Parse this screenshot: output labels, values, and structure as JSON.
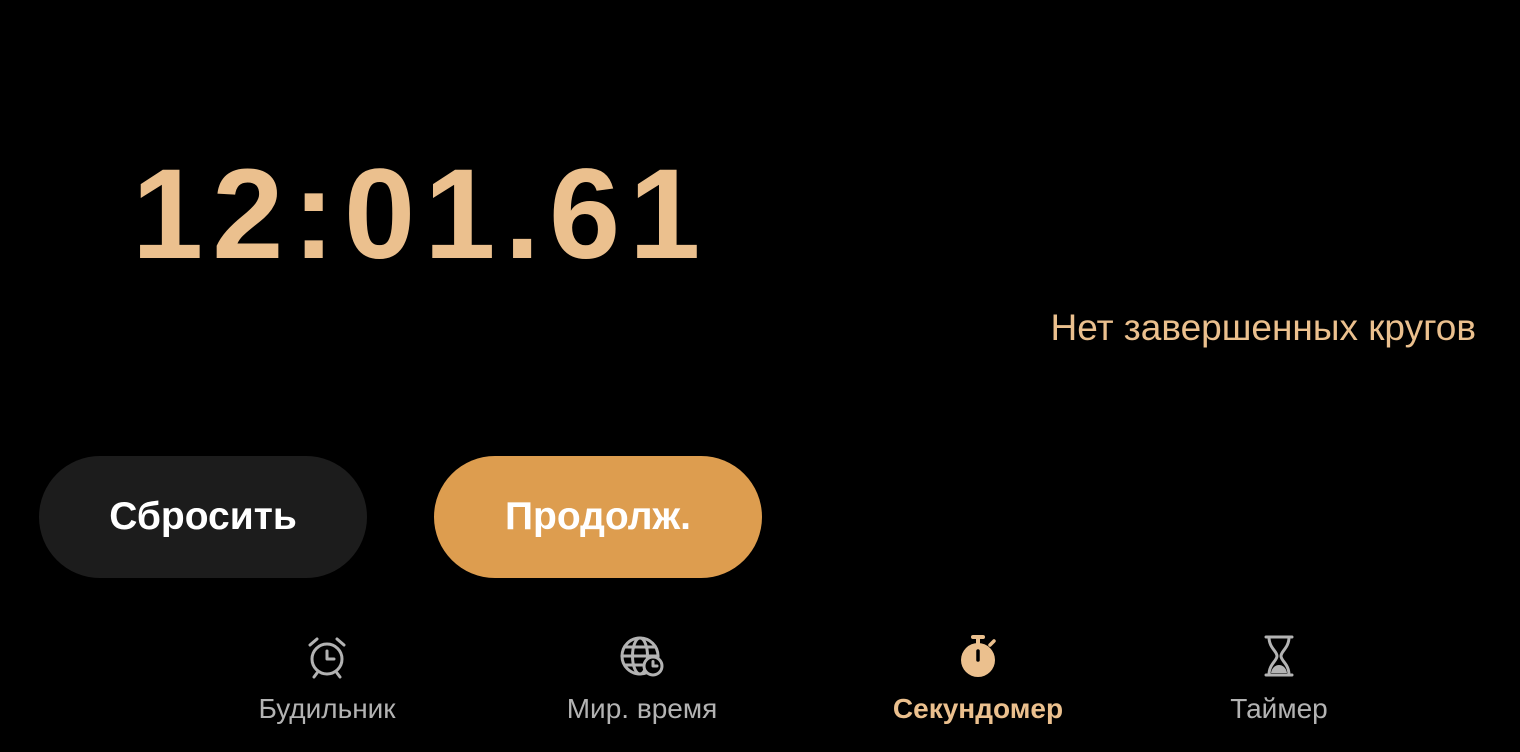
{
  "stopwatch": {
    "time": "12:01.61",
    "laps_empty_text": "Нет завершенных кругов"
  },
  "actions": {
    "reset_label": "Сбросить",
    "resume_label": "Продолж."
  },
  "nav": {
    "items": [
      {
        "label": "Будильник",
        "icon": "alarm-clock-icon",
        "active": false
      },
      {
        "label": "Мир. время",
        "icon": "world-clock-icon",
        "active": false
      },
      {
        "label": "Секундомер",
        "icon": "stopwatch-icon",
        "active": true
      },
      {
        "label": "Таймер",
        "icon": "hourglass-icon",
        "active": false
      }
    ]
  },
  "colors": {
    "background": "#000000",
    "accent_text": "#ebc08e",
    "primary_button": "#dd9d4f",
    "secondary_button": "#1c1c1c",
    "inactive_nav": "#b3b3b3"
  }
}
